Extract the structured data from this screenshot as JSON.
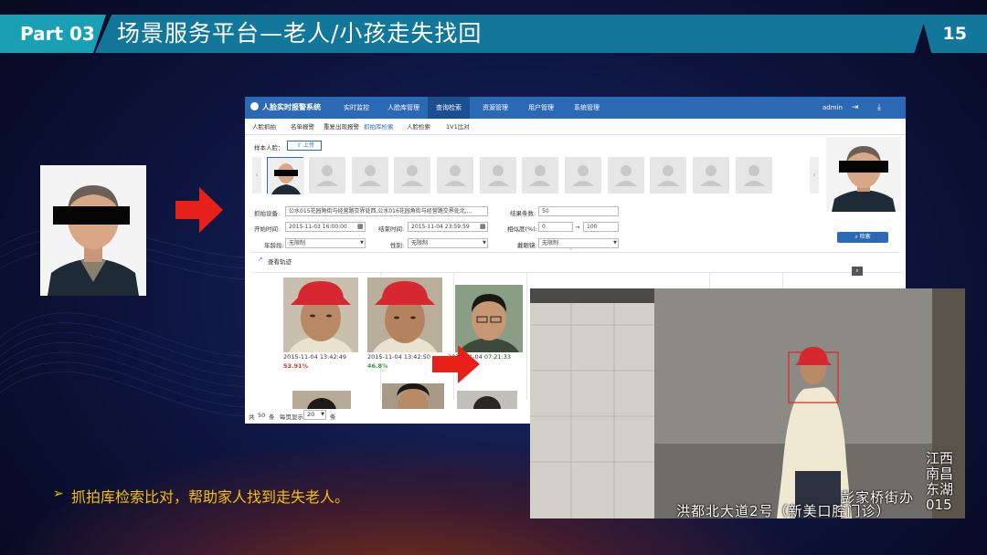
{
  "header": {
    "part": "Part 03",
    "title": "场景服务平台—老人/小孩走失找回",
    "page": "15"
  },
  "app": {
    "brand": "人脸实时报警系统",
    "menu": [
      "实时监控",
      "人脸库管理",
      "查询检索",
      "资源管理",
      "用户管理",
      "系统管理"
    ],
    "active_menu": "查询检索",
    "user": "admin",
    "subnav": [
      "人脸抓拍",
      "名单报警",
      "重复出现报警",
      "抓拍库检索",
      "人脸检索",
      "1V1比对"
    ],
    "active_subnav": "抓拍库检索",
    "sample_label": "样本人脸：",
    "upload_label": "上传",
    "form": {
      "device_label": "抓拍设备:",
      "device_value": "公水015花园角街与经营路交界处西,公水016花园角街与经营路交界处北,...",
      "count_label": "结果条数:",
      "count_value": "50",
      "start_label": "开始时间:",
      "start_value": "2015-11-03 16:00:00",
      "end_label": "结束时间:",
      "end_value": "2015-11-04 23:59:59",
      "sim_label": "相似度(%):",
      "sim_from": "0",
      "sim_arrow": "→",
      "sim_to": "100",
      "age_label": "年龄段:",
      "age_value": "无限制",
      "gender_label": "性别:",
      "gender_value": "无限制",
      "glasses_label": "戴眼镜:",
      "glasses_value": "无限制",
      "search_button": "检索"
    },
    "track_label": "查看轨迹",
    "results": [
      {
        "time": "2015-11-04 13:42:49",
        "pct": "53.91%",
        "pct_color": "#d9371f"
      },
      {
        "time": "2015-11-04 13:42:50",
        "pct": "46.8%",
        "pct_color": "#2f9a3a"
      },
      {
        "time": "2015-11-04 07:21:33",
        "pct": "",
        "pct_color": "#333"
      }
    ],
    "footer": {
      "total_prefix": "共",
      "total_value": "50",
      "total_suffix": "条",
      "per_page_label": "每页显示",
      "per_page_value": "20",
      "per_page_suffix": "条"
    }
  },
  "street_overlay": {
    "line1": "洪都北大道2号（新美口腔门诊）",
    "line2": "彭家桥街办",
    "side": "江西 南昌 东湖 015"
  },
  "bullet": {
    "marker": "➢",
    "text": "抓拍库检索比对，帮助家人找到走失老人。"
  },
  "colors": {
    "accent": "#1aa0b4",
    "banner": "#12779b",
    "bullet": "#f5c000",
    "arrow": "#e8201a",
    "app_nav": "#2b69b5"
  }
}
